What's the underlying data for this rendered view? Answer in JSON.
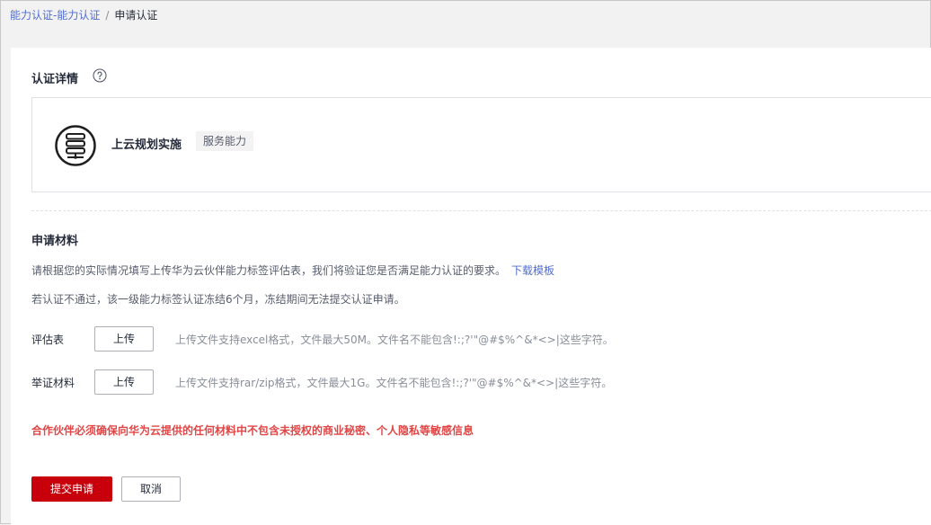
{
  "breadcrumb": {
    "parent": "能力认证-能力认证",
    "separator": "/",
    "current": "申请认证"
  },
  "details": {
    "title": "认证详情",
    "help_icon": "question-circle-icon",
    "service_icon": "server-icon",
    "service_name": "上云规划实施",
    "service_tag": "服务能力"
  },
  "materials": {
    "title": "申请材料",
    "description": "请根据您的实际情况填写上传华为云伙伴能力标签评估表，我们将验证您是否满足能力认证的要求。",
    "download_link": "下载模板",
    "notice": "若认证不通过，该一级能力标签认证冻结6个月，冻结期间无法提交认证申请。",
    "rows": [
      {
        "label": "评估表",
        "button": "上传",
        "hint": "上传文件支持excel格式，文件最大50M。文件名不能包含!:;?'\"@#$%^&*<>|这些字符。"
      },
      {
        "label": "举证材料",
        "button": "上传",
        "hint": "上传文件支持rar/zip格式，文件最大1G。文件名不能包含!:;?'\"@#$%^&*<>|这些字符。"
      }
    ],
    "warning": "合作伙伴必须确保向华为云提供的任何材料中不包含未授权的商业秘密、个人隐私等敏感信息"
  },
  "actions": {
    "submit": "提交申请",
    "cancel": "取消"
  },
  "colors": {
    "primary": "#c7000b",
    "link": "#526ecc",
    "warning": "#e04646"
  }
}
